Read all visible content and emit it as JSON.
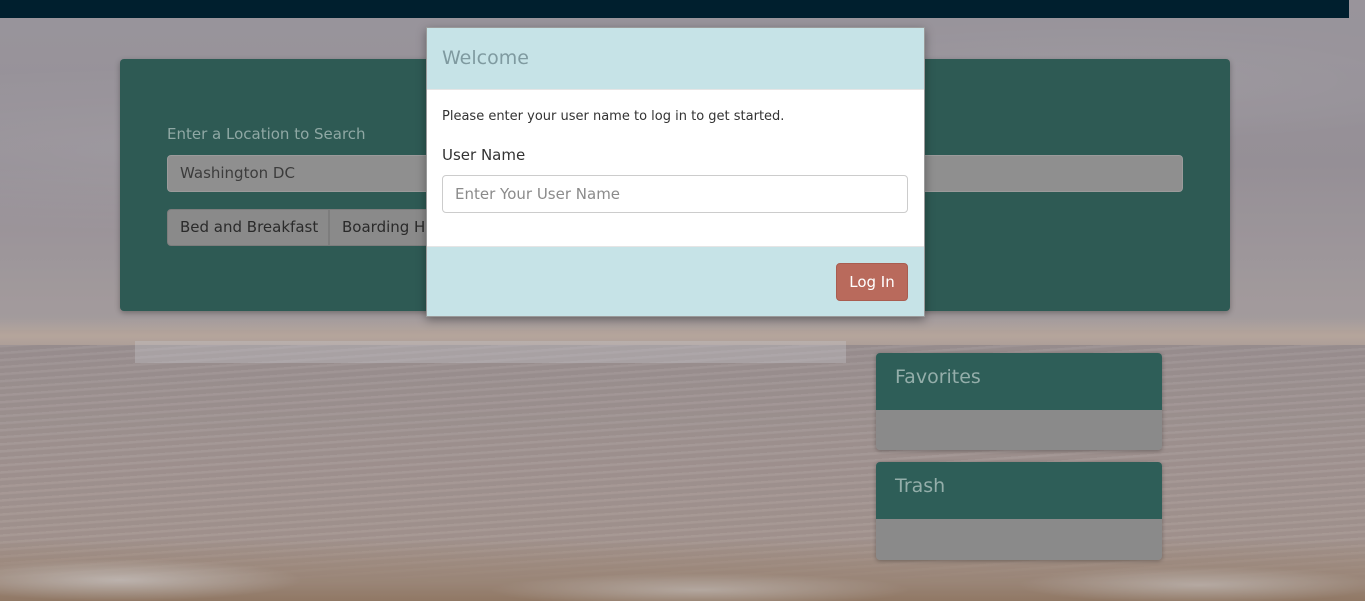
{
  "search": {
    "label": "Enter a Location to Search",
    "value": "Washington DC",
    "type_buttons": [
      "Bed and Breakfast",
      "Boarding H"
    ]
  },
  "sidebar": {
    "favorites_title": "Favorites",
    "trash_title": "Trash"
  },
  "modal": {
    "title": "Welcome",
    "intro": "Please enter your user name to log in to get started.",
    "field_label": "User Name",
    "field_placeholder": "Enter Your User Name",
    "field_value": "",
    "submit_label": "Log In"
  },
  "colors": {
    "topbar": "#001f2e",
    "panel": "#2e5a54",
    "modal_header": "#c6e3e7",
    "login_button": "#b96a5c"
  }
}
